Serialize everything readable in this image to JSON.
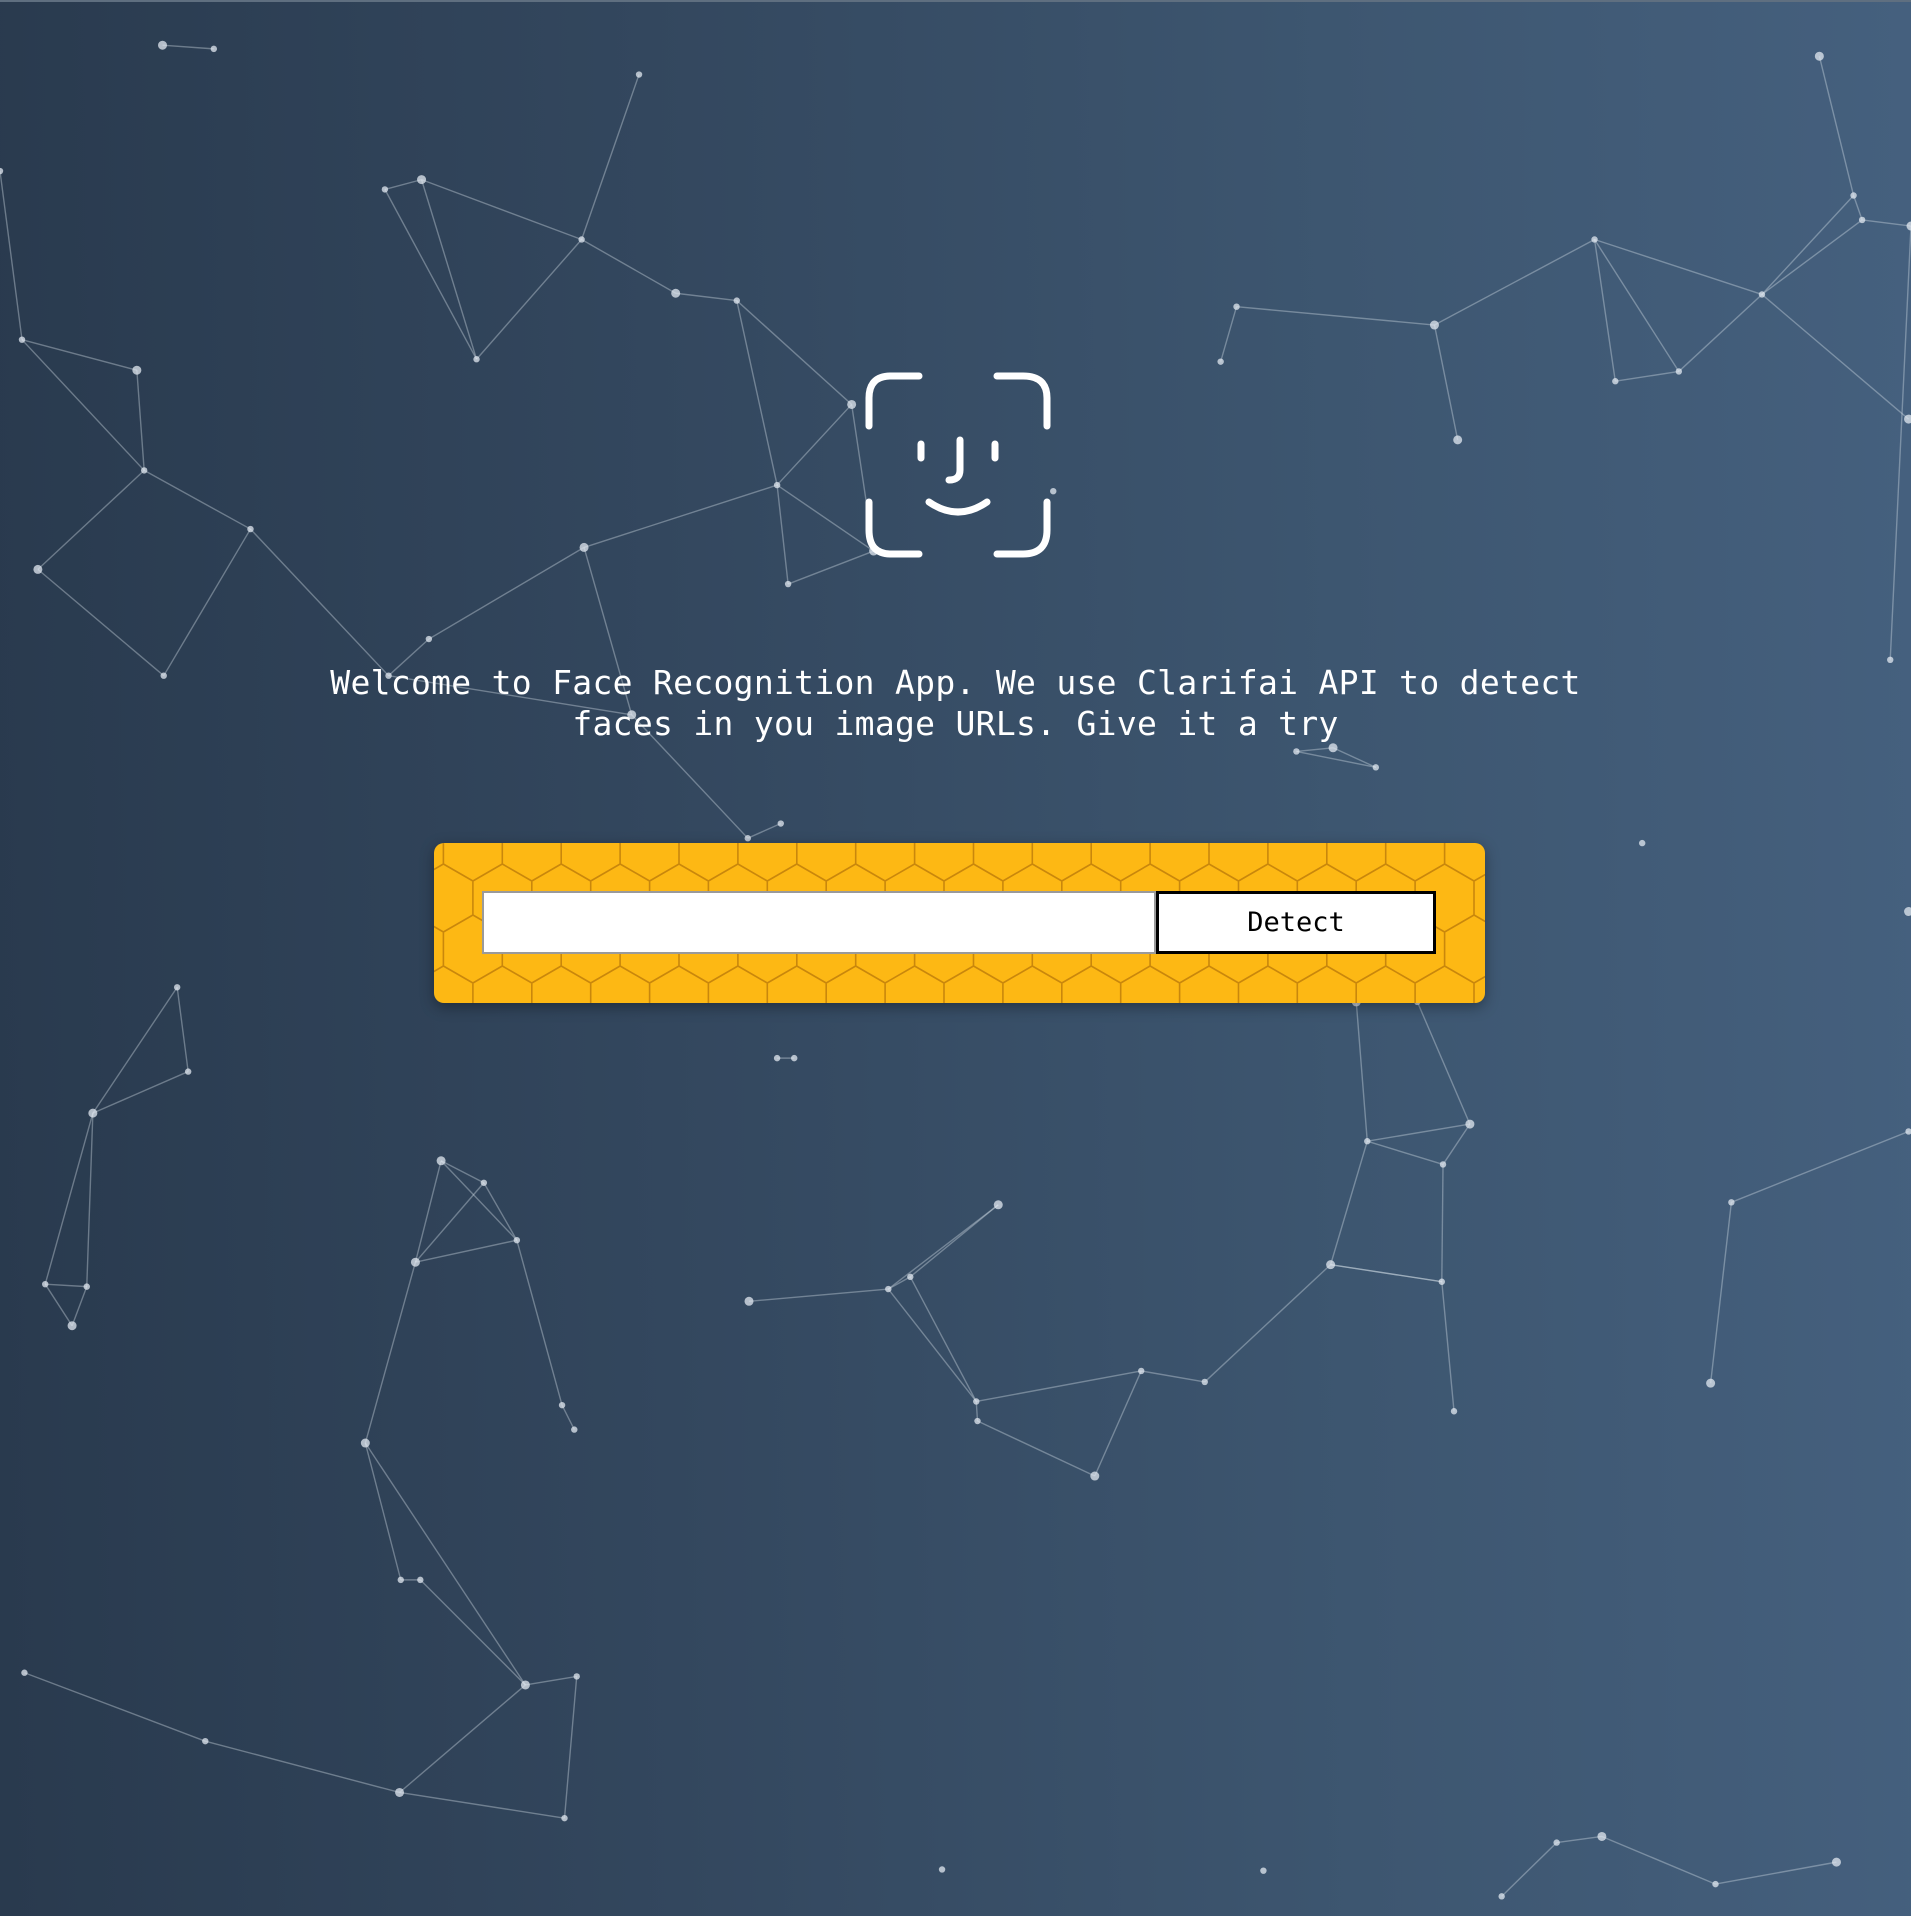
{
  "intro": {
    "text": "Welcome to Face Recognition App. We use Clarifai API to detect faces in you image URLs. Give it a try"
  },
  "form": {
    "input_value": "",
    "input_placeholder": "",
    "button_label": "Detect"
  },
  "colors": {
    "background_start": "#293a4e",
    "background_end": "#45607e",
    "panel_accent": "#fdb814",
    "text": "#ffffff"
  },
  "icons": {
    "logo": "face-id-icon"
  }
}
